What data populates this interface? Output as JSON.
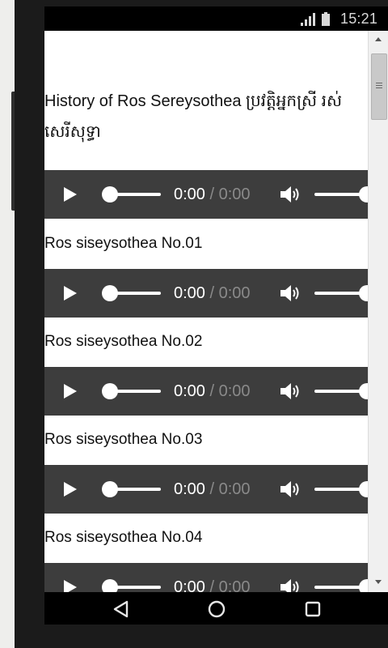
{
  "status_bar": {
    "time": "15:21",
    "signal_icon": "signal-bars-icon",
    "battery_icon": "battery-icon"
  },
  "page": {
    "heading": "History of Ros Sereysothea ប្រវត្តិអ្នកស្រី រស់ សេរីសុទ្ធា",
    "tracks": [
      {
        "title": "",
        "current_time": "0:00",
        "duration": "/ 0:00"
      },
      {
        "title": "Ros siseysothea No.01",
        "current_time": "0:00",
        "duration": "/ 0:00"
      },
      {
        "title": "Ros siseysothea No.02",
        "current_time": "0:00",
        "duration": "/ 0:00"
      },
      {
        "title": "Ros siseysothea No.03",
        "current_time": "0:00",
        "duration": "/ 0:00"
      },
      {
        "title": "Ros siseysothea No.04",
        "current_time": "0:00",
        "duration": "/ 0:00"
      }
    ]
  },
  "player_icons": {
    "play": "play-icon",
    "volume": "volume-icon"
  },
  "nav_bar": {
    "back": "back-triangle-icon",
    "home": "home-circle-icon",
    "recents": "recents-square-icon"
  },
  "colors": {
    "player_background": "#3d3d3d",
    "duration_text": "#8a8a8a",
    "page_background": "#ffffff"
  }
}
